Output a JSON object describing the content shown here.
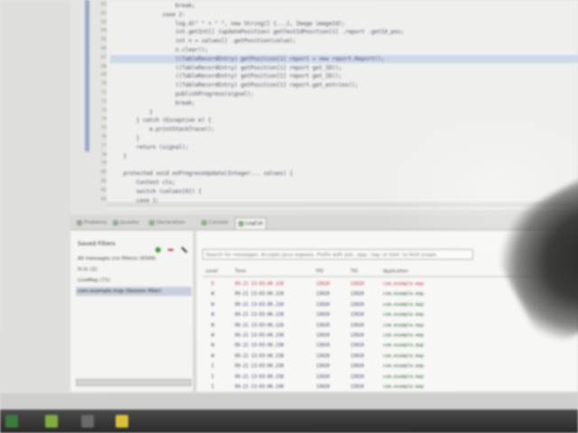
{
  "editor": {
    "lines": [
      {
        "num": "61",
        "text": "                    break;",
        "hl": false
      },
      {
        "num": "62",
        "text": "                case 2:",
        "hl": false
      },
      {
        "num": "63",
        "text": "                    log.d(\" \" + \" \", new String[] {...}, Image imageId);",
        "hl": false
      },
      {
        "num": "64",
        "text": "                    int.getInt[] (updatePosition) getTextIdPosition[1] .report .getId_pos;",
        "hl": false
      },
      {
        "num": "65",
        "text": "                    int n = values[] .getPosition(value);",
        "hl": false
      },
      {
        "num": "66",
        "text": "                    n.clear();",
        "hl": false
      },
      {
        "num": "67",
        "text": "                    ((TableRecordEntry) getPosition[1] report = new report.Report();",
        "hl": true
      },
      {
        "num": "68",
        "text": "                    ((TableRecordEntry) getPosition[1] report get_ID();",
        "hl": false
      },
      {
        "num": "69",
        "text": "                    ((TableRecordEntry) getPosition[1] report get_ID();",
        "hl": false
      },
      {
        "num": "70",
        "text": "                    ((TableRecordEntry) getPosition[1] report.get_entries();",
        "hl": false
      },
      {
        "num": "71",
        "text": "                    publishProgress(signal);",
        "hl": false
      },
      {
        "num": "72",
        "text": "                    break;",
        "hl": false
      },
      {
        "num": "73",
        "text": "            }",
        "hl": false
      },
      {
        "num": "74",
        "text": "        } catch (Exception e) {",
        "hl": false
      },
      {
        "num": "75",
        "text": "            e.printStackTrace();",
        "hl": false
      },
      {
        "num": "76",
        "text": "        }",
        "hl": false
      },
      {
        "num": "77",
        "text": "        return (signal);",
        "hl": false
      },
      {
        "num": "78",
        "text": "    }",
        "hl": false
      },
      {
        "num": "79",
        "text": "",
        "hl": false
      },
      {
        "num": "80",
        "text": "    protected void onProgressUpdate(Integer... values) {",
        "hl": false
      },
      {
        "num": "81",
        "text": "        Context ctx;",
        "hl": false
      },
      {
        "num": "82",
        "text": "        switch (values[0]) {",
        "hl": false
      },
      {
        "num": "83",
        "text": "        case 1:",
        "hl": false
      }
    ]
  },
  "tabs": [
    {
      "label": "Problems",
      "active": false
    },
    {
      "label": "Javadoc",
      "active": false
    },
    {
      "label": "Declaration",
      "active": false
    },
    {
      "label": "Console",
      "active": false
    },
    {
      "label": "LogCat",
      "active": true
    }
  ],
  "filters": {
    "title": "Saved Filters",
    "items": [
      {
        "label": "All messages (no filters) (9349)",
        "selected": false
      },
      {
        "label": "hi.tc (2)",
        "selected": false
      },
      {
        "label": "LiveMap (71)",
        "selected": false
      },
      {
        "label": "com.example.map (Session filter)",
        "selected": true
      }
    ]
  },
  "log": {
    "search_placeholder": "Search for messages. Accepts Java regexes. Prefix with pid:, app:, tag: or text: to limit scope.",
    "headers": {
      "level": "Level",
      "time": "Time",
      "pid": "PID",
      "tid": "TID",
      "app": "Application"
    },
    "rows": [
      {
        "level": "E",
        "time": "09-21 13:03:06.228",
        "pid": "13020",
        "tid": "13020",
        "app": "com.example.map",
        "err": true
      },
      {
        "level": "W",
        "time": "09-21 13:03:06.228",
        "pid": "13020",
        "tid": "13020",
        "app": "com.example.map",
        "err": false
      },
      {
        "level": "W",
        "time": "09-21 13:03:06.228",
        "pid": "13020",
        "tid": "13020",
        "app": "com.example.map",
        "err": false
      },
      {
        "level": "W",
        "time": "09-21 13:03:06.228",
        "pid": "13020",
        "tid": "13020",
        "app": "com.example.map",
        "err": false
      },
      {
        "level": "W",
        "time": "09-21 13:03:06.228",
        "pid": "13020",
        "tid": "13020",
        "app": "com.example.map",
        "err": false
      },
      {
        "level": "W",
        "time": "09-21 13:03:06.238",
        "pid": "13020",
        "tid": "13020",
        "app": "com.example.map",
        "err": false
      },
      {
        "level": "W",
        "time": "09-21 13:03:06.238",
        "pid": "13020",
        "tid": "13020",
        "app": "com.example.map",
        "err": false
      },
      {
        "level": "W",
        "time": "09-21 13:03:06.238",
        "pid": "13020",
        "tid": "13020",
        "app": "com.example.map",
        "err": false
      },
      {
        "level": "I",
        "time": "09-21 13:03:06.238",
        "pid": "13020",
        "tid": "13020",
        "app": "com.example.map",
        "err": false
      },
      {
        "level": "I",
        "time": "09-21 13:03:06.238",
        "pid": "13020",
        "tid": "13020",
        "app": "com.example.map",
        "err": false
      },
      {
        "level": "I",
        "time": "09-21 13:03:06.248",
        "pid": "13020",
        "tid": "13020",
        "app": "com.example.map",
        "err": false
      }
    ]
  },
  "colors": {
    "editor_bg": "#efefed",
    "highlight_line": "#cfd7ea",
    "error_text": "#c0363a",
    "taskbar": "#2a2a2a"
  }
}
